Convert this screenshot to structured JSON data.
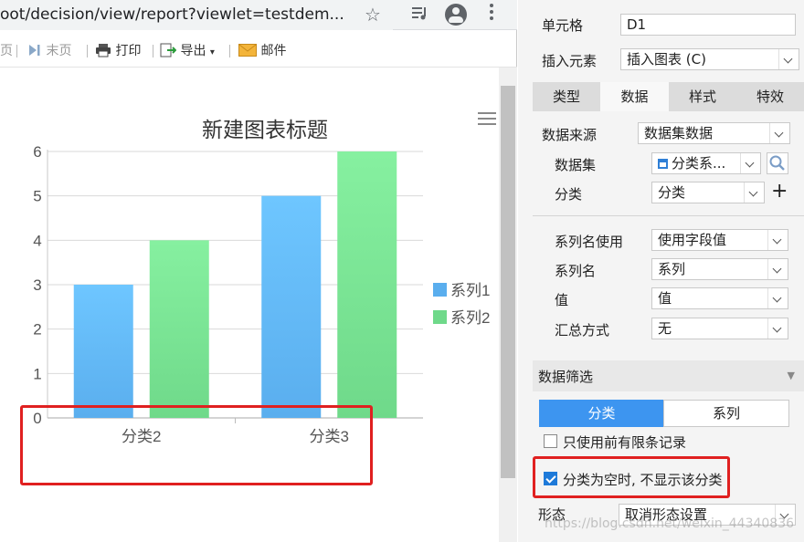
{
  "browser": {
    "url_prefix": "oot/decision/view/report?viewlet=testdem...",
    "icons": {
      "star": "star-icon",
      "media": "media-control-icon",
      "profile": "account-icon",
      "menu": "more-vert-icon"
    }
  },
  "toolbar": {
    "prev_page_label": "页",
    "last_page_label": "末页",
    "print_label": "打印",
    "export_label": "导出",
    "mail_label": "邮件"
  },
  "chart_data": {
    "type": "bar",
    "title": "新建图表标题",
    "categories": [
      "分类2",
      "分类3"
    ],
    "series": [
      {
        "name": "系列1",
        "values": [
          3,
          5
        ],
        "color_top": "#6ec6ff",
        "color_bottom": "#5aaeee"
      },
      {
        "name": "系列2",
        "values": [
          4,
          6
        ],
        "color_top": "#86f0a0",
        "color_bottom": "#6fd98a"
      }
    ],
    "ylim": [
      0,
      6
    ],
    "yticks": [
      0,
      1,
      2,
      3,
      4,
      5,
      6
    ],
    "grid": true,
    "legend": "right"
  },
  "panel": {
    "cell_label": "单元格",
    "cell_value": "D1",
    "insert_label": "插入元素",
    "insert_value": "插入图表 (C)",
    "tabs": [
      "类型",
      "数据",
      "样式",
      "特效"
    ],
    "active_tab": "数据",
    "source_label": "数据来源",
    "source_value": "数据集数据",
    "dataset_label": "数据集",
    "dataset_value": "分类系...",
    "category_label": "分类",
    "category_value": "分类",
    "series_name_use_label": "系列名使用",
    "series_name_use_value": "使用字段值",
    "series_name_label": "系列名",
    "series_name_value": "系列",
    "value_label": "值",
    "value_value": "值",
    "summary_label": "汇总方式",
    "summary_value": "无",
    "filter_label": "数据筛选",
    "filter_seg_category": "分类",
    "filter_seg_series": "系列",
    "top_n_label": "只使用前有限条记录",
    "hide_empty_label": "分类为空时, 不显示该分类",
    "form_label": "形态",
    "form_value": "取消形态设置"
  },
  "watermark": "https://blog.csdn.net/weixin_44340836"
}
